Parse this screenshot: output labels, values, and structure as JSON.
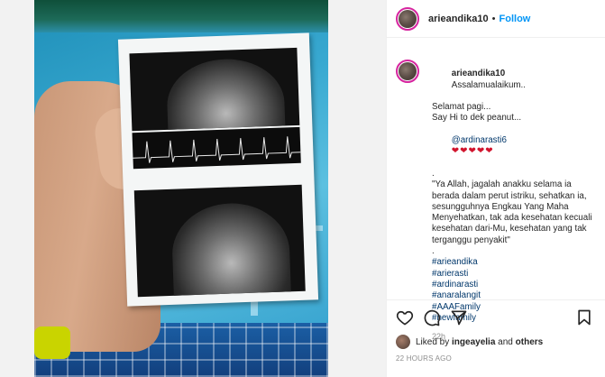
{
  "post": {
    "username": "arieandika10",
    "separator": "•",
    "follow_label": "Follow"
  },
  "caption": {
    "username": "arieandika10",
    "first_line": "Assalamualaikum..",
    "lines": [
      "Selamat pagi...",
      "Say Hi to dek peanut..."
    ],
    "mention": "@ardinarasti6",
    "hearts": "❤❤❤❤❤",
    "dot_line": ".",
    "quote": "\"Ya Allah, jagalah anakku selama ia berada dalam perut istriku, sehatkan ia, sesungguhnya Engkau Yang Maha Menyehatkan, tak ada kesehatan kecuali kesehatan dari-Mu, kesehatan yang tak terganggu penyakit\"",
    "dot_line2": ".",
    "hashtags": [
      "#arieandika",
      "#arierasti",
      "#ardinarasti",
      "#anaralangit",
      "#AAAFamily",
      "#newfamily"
    ],
    "age": "22h"
  },
  "actions": {
    "liked_by_prefix": "Liked by",
    "liked_by_user": "ingeayelia",
    "liked_by_and": "and",
    "liked_by_others": "others",
    "posted_time": "22 HOURS AGO"
  },
  "icons": [
    "heart-icon",
    "comment-icon",
    "share-icon",
    "bookmark-icon"
  ],
  "colors": {
    "follow": "#0095f6",
    "link": "#00376b",
    "muted": "#8e8e8e",
    "story_ring": "#d6249f"
  }
}
